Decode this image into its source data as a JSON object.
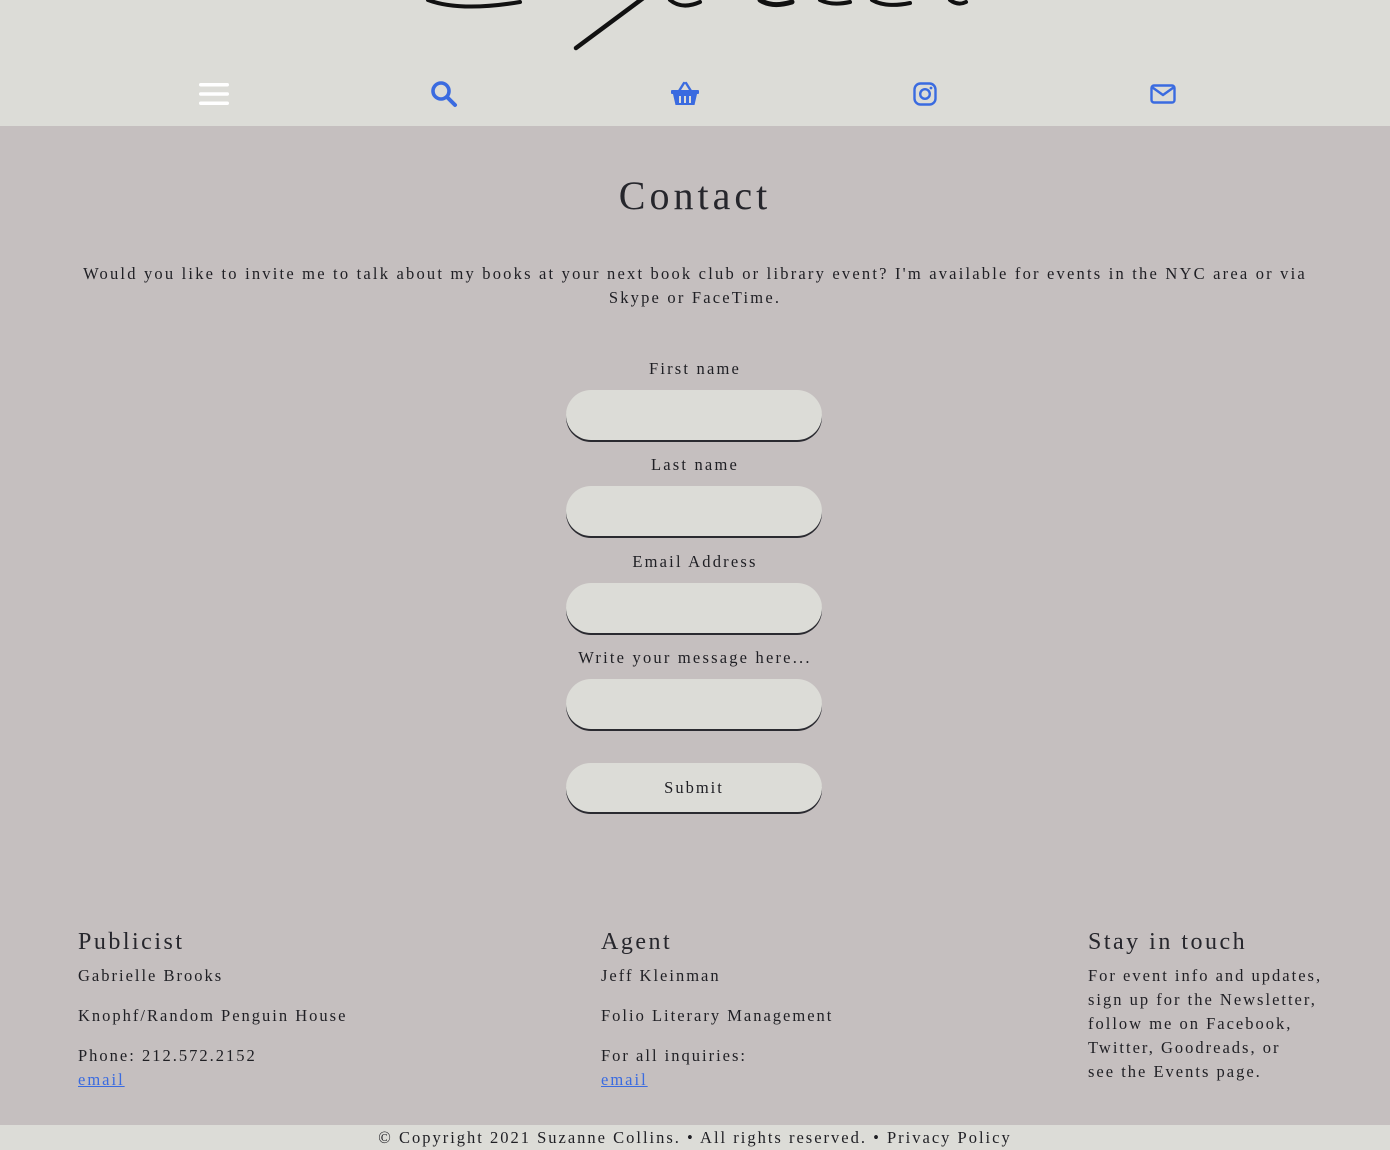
{
  "nav": {
    "items": [
      {
        "name": "menu-icon",
        "color": "#ffffff"
      },
      {
        "name": "search-icon",
        "color": "#3a6be0"
      },
      {
        "name": "basket-icon",
        "color": "#3a6be0"
      },
      {
        "name": "instagram-icon",
        "color": "#3a6be0"
      },
      {
        "name": "envelope-icon",
        "color": "#3a6be0"
      }
    ]
  },
  "main": {
    "title": "Contact",
    "intro": "Would you like to invite me to talk about my books at your next book club or library event? I'm available for events in the NYC area or via Skype or FaceTime."
  },
  "form": {
    "first_name_label": "First name",
    "first_name_value": "",
    "last_name_label": "Last name",
    "last_name_value": "",
    "email_label": "Email Address",
    "email_value": "",
    "message_label": "Write your message here...",
    "message_value": "",
    "submit_label": "Submit"
  },
  "footer": {
    "publicist": {
      "heading": "Publicist",
      "name": "Gabrielle Brooks",
      "company": "Knophf/Random Penguin House",
      "phone": "Phone: 212.572.2152",
      "email_link": "email"
    },
    "agent": {
      "heading": "Agent",
      "name": "Jeff Kleinman",
      "company": "Folio Literary Management",
      "inquiries": "For all inquiries:",
      "email_link": "email"
    },
    "stay": {
      "heading": "Stay in touch",
      "lines": [
        "For event info and updates,",
        "sign up for the Newsletter,",
        "follow me on Facebook,",
        "Twitter, Goodreads, or",
        "see the Events page."
      ]
    },
    "copyright": "© Copyright 2021 Suzanne Collins. • All rights reserved. • Privacy Policy"
  },
  "colors": {
    "page_bg": "#c5bfbf",
    "header_bg": "#dcdcd7",
    "accent": "#3a6be0"
  }
}
